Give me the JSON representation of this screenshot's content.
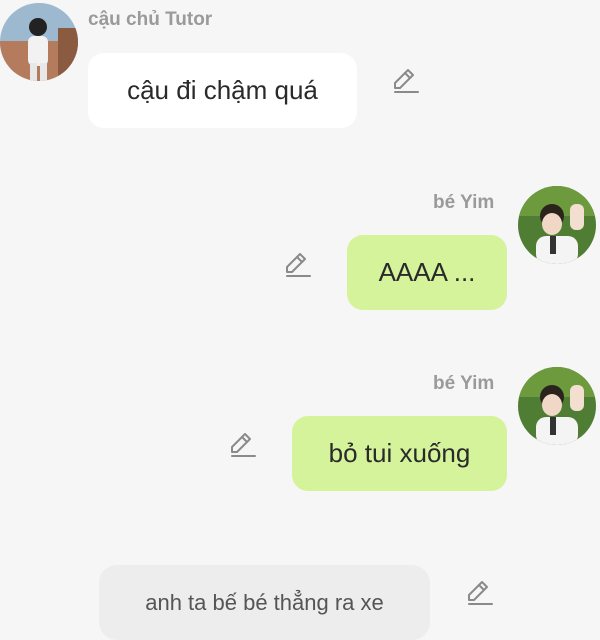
{
  "messages": [
    {
      "sender": "cậu chủ Tutor",
      "text": "cậu đi chậm quá",
      "side": "left"
    },
    {
      "sender": "bé Yim",
      "text": "AAAA ...",
      "side": "right"
    },
    {
      "sender": "bé Yim",
      "text": "bỏ tui xuống",
      "side": "right"
    }
  ],
  "narration": {
    "text": "anh ta bế bé thẳng ra xe"
  },
  "colors": {
    "background": "#f6f6f6",
    "incoming_bubble": "#ffffff",
    "outgoing_bubble": "#d5f39b",
    "narration_bubble": "#ededed",
    "name_text": "#9a9a9a"
  },
  "icons": {
    "edit": "pencil-edit-icon",
    "avatar_left": "avatar-tutor",
    "avatar_right": "avatar-yim"
  }
}
